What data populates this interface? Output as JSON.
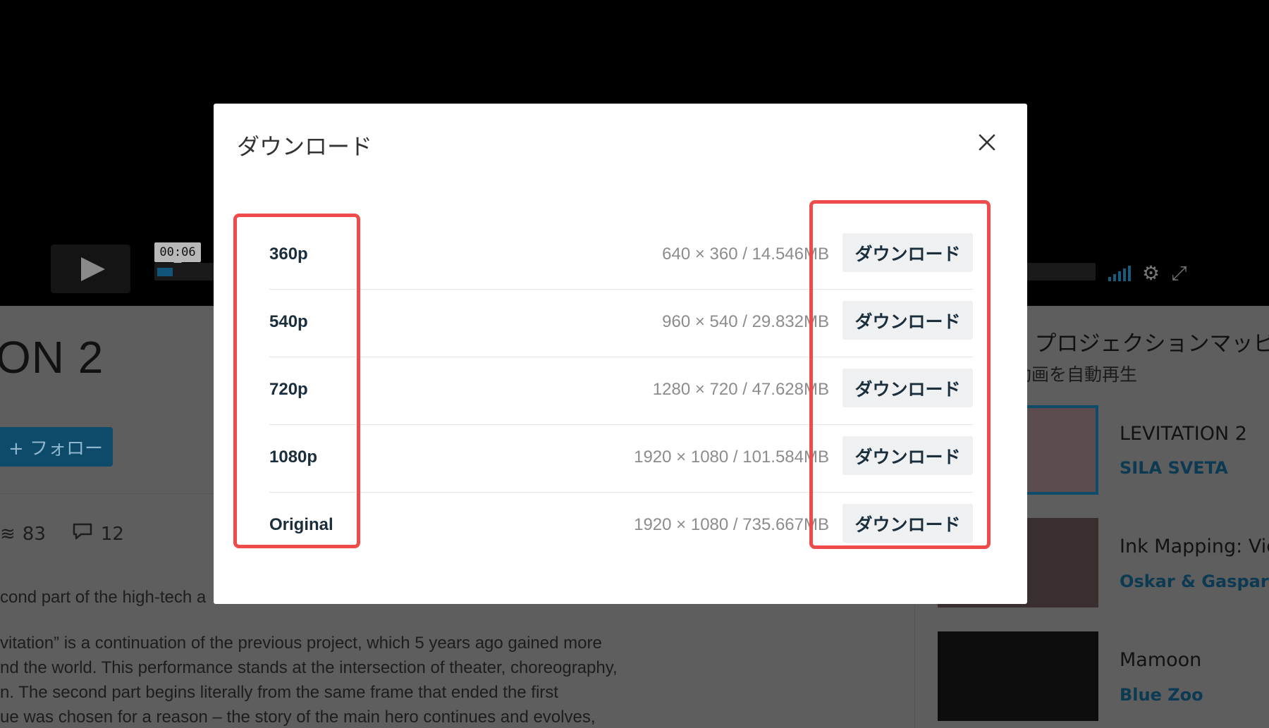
{
  "player": {
    "time_tooltip": "00:06",
    "progress": 0.016
  },
  "page": {
    "title_fragment": "ON 2",
    "follow_label": "+ フォロー",
    "likes_count": "83",
    "comments_count": "12",
    "description_lines": [
      "cond part of the high-tech a",
      "vitation” is a continuation of the previous project, which 5 years ago gained more",
      "nd the world. This performance stands at the intersection of theater, choreography,",
      "n. The second part begins literally from the same frame that ended the first",
      "ue was chosen for a reason – the story of the main hero continues and evolves,"
    ]
  },
  "sidebar": {
    "heading": "n プロジェクションマッピ",
    "subheading": "動画を自動再生",
    "items": [
      {
        "title": "LEVITATION 2",
        "author": "SILA SVETA"
      },
      {
        "title": "Ink Mapping: Vid",
        "author": "Oskar & Gaspar"
      },
      {
        "title": "Mamoon",
        "author": "Blue Zoo"
      }
    ]
  },
  "modal": {
    "title": "ダウンロード",
    "close_icon": "close-icon",
    "rows": [
      {
        "resolution": "360p",
        "info": "640 × 360 / 14.546MB",
        "button": "ダウンロード"
      },
      {
        "resolution": "540p",
        "info": "960 × 540 / 29.832MB",
        "button": "ダウンロード"
      },
      {
        "resolution": "720p",
        "info": "1280 × 720 / 47.628MB",
        "button": "ダウンロード"
      },
      {
        "resolution": "1080p",
        "info": "1920 × 1080 / 101.584MB",
        "button": "ダウンロード"
      },
      {
        "resolution": "Original",
        "info": "1920 × 1080 / 735.667MB",
        "button": "ダウンロード"
      }
    ]
  },
  "colors": {
    "highlight": "#ef4b4b",
    "accent": "#0e4a6a",
    "overlay_bg": "#5e5e5e"
  }
}
